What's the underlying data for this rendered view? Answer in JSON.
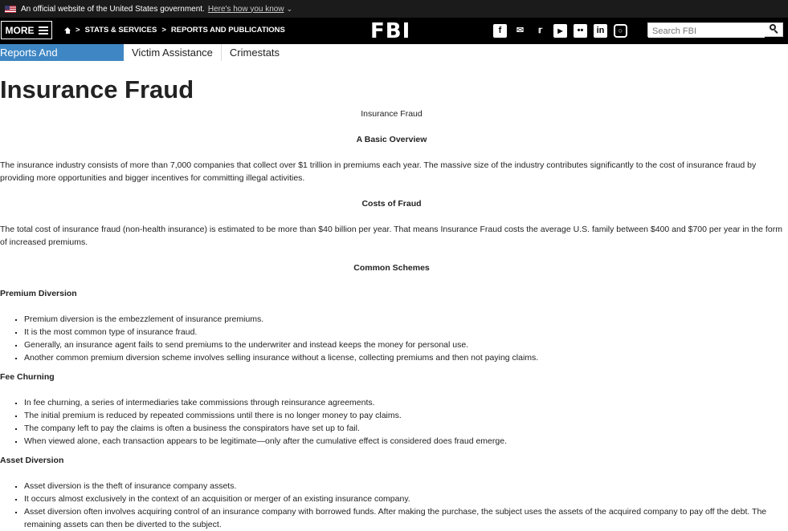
{
  "gov_banner": {
    "text": "An official website of the United States government.",
    "link": "Here's how you know"
  },
  "topnav": {
    "more_label": "MORE",
    "crumbs": [
      "STATS & SERVICES",
      "REPORTS AND PUBLICATIONS"
    ],
    "crumb_sep": ">",
    "logo": "FBI",
    "social": [
      "facebook-icon",
      "email-icon",
      "twitter-icon",
      "youtube-icon",
      "flickr-icon",
      "linkedin-icon",
      "instagram-icon"
    ],
    "search_placeholder": "Search FBI"
  },
  "subnav": {
    "tabs": [
      "Reports And Publications",
      "Victim Assistance",
      "Crimestats"
    ]
  },
  "page_title": "Insurance Fraud",
  "article": {
    "doc_title": "Insurance Fraud",
    "overview_heading": "A Basic Overview",
    "overview_text": "The insurance industry consists of more than 7,000 companies that collect over $1 trillion in premiums each year. The massive size of the industry contributes significantly to the cost of insurance fraud by providing more opportunities and bigger incentives for committing illegal activities.",
    "costs_heading": "Costs of Fraud",
    "costs_text": "The total cost of insurance fraud (non-health insurance) is estimated to be more than $40 billion per year. That means Insurance Fraud costs the average U.S. family between $400 and $700 per year in the form of increased premiums.",
    "schemes_heading": "Common Schemes",
    "premium_heading": "Premium Diversion",
    "premium_items": [
      "Premium diversion is the embezzlement of insurance premiums.",
      "It is the most common type of insurance fraud.",
      "Generally, an insurance agent fails to send premiums to the underwriter and instead keeps the money for personal use.",
      "Another common premium diversion scheme involves selling insurance without a license, collecting premiums and then not paying claims."
    ],
    "fee_heading": "Fee Churning",
    "fee_items": [
      "In fee churning, a series of intermediaries take commissions through reinsurance agreements.",
      "The initial premium is reduced by repeated commissions until there is no longer money to pay claims.",
      "The company left to pay the claims is often a business the conspirators have set up to fail.",
      "When viewed alone, each transaction appears to be legitimate—only after the cumulative effect is considered does fraud emerge."
    ],
    "asset_heading": "Asset Diversion",
    "asset_items": [
      "Asset diversion is the theft of insurance company assets.",
      "It occurs almost exclusively in the context of an acquisition or merger of an existing insurance company.",
      "Asset diversion often involves acquiring control of an insurance company with borrowed funds. After making the purchase, the subject uses the assets of the acquired company to pay off the debt. The remaining assets can then be diverted to the subject."
    ]
  }
}
